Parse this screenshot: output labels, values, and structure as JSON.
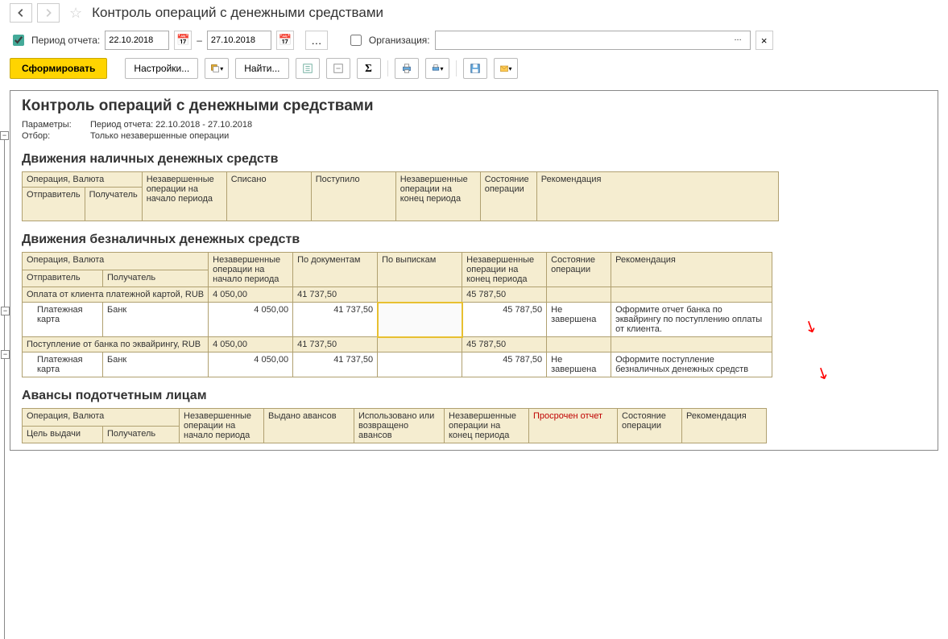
{
  "title": "Контроль операций с денежными средствами",
  "params": {
    "period_label": "Период отчета:",
    "from": "22.10.2018",
    "to": "27.10.2018",
    "dash": "–",
    "org_label": "Организация:",
    "org_ellipsis": "...",
    "clear": "×"
  },
  "toolbar": {
    "form": "Сформировать",
    "settings": "Настройки...",
    "find": "Найти..."
  },
  "report": {
    "title": "Контроль операций с денежными средствами",
    "meta": {
      "params_label": "Параметры:",
      "params_value": "Период отчета: 22.10.2018 - 27.10.2018",
      "filter_label": "Отбор:",
      "filter_value": "Только незавершенные операции"
    },
    "section1": {
      "title": "Движения наличных денежных средств",
      "headers": {
        "op": "Операция, Валюта",
        "unfinished_start": "Незавершенные операции на начало периода",
        "written_off": "Списано",
        "received": "Поступило",
        "unfinished_end": "Незавершенные операции на конец периода",
        "state": "Состояние операции",
        "rec": "Рекомендация",
        "sender": "Отправитель",
        "recipient": "Получатель"
      }
    },
    "section2": {
      "title": "Движения безналичных денежных средств",
      "headers": {
        "op": "Операция, Валюта",
        "unfinished_start": "Незавершенные операции на начало периода",
        "by_docs": "По документам",
        "by_statements": "По выпискам",
        "unfinished_end": "Незавершенные операции на конец периода",
        "state": "Состояние операции",
        "rec": "Рекомендация",
        "sender": "Отправитель",
        "recipient": "Получатель"
      },
      "rows": {
        "g1": "Оплата от клиента платежной картой, RUB",
        "g1_start": "4 050,00",
        "g1_docs": "41 737,50",
        "g1_stmts": "",
        "g1_end": "45 787,50",
        "d1_sender": "Платежная карта",
        "d1_recipient": "Банк",
        "d1_start": "4 050,00",
        "d1_docs": "41 737,50",
        "d1_end": "45 787,50",
        "d1_state": "Не завершена",
        "d1_rec": "Оформите отчет банка по эквайрингу по поступлению оплаты от клиента.",
        "g2": "Поступление от банка по эквайрингу, RUB",
        "g2_start": "4 050,00",
        "g2_docs": "41 737,50",
        "g2_end": "45 787,50",
        "d2_sender": "Платежная карта",
        "d2_recipient": "Банк",
        "d2_start": "4 050,00",
        "d2_docs": "41 737,50",
        "d2_end": "45 787,50",
        "d2_state": "Не завершена",
        "d2_rec": "Оформите поступление безналичных денежных средств"
      }
    },
    "section3": {
      "title": "Авансы подотчетным лицам",
      "headers": {
        "op": "Операция, Валюта",
        "unfinished_start": "Незавершенные операции на начало периода",
        "issued": "Выдано авансов",
        "used": "Использовано или возвращено авансов",
        "unfinished_end": "Незавершенные операции на конец периода",
        "overdue": "Просрочен отчет",
        "state": "Состояние операции",
        "rec": "Рекомендация",
        "purpose": "Цель выдачи",
        "recipient": "Получатель"
      }
    }
  }
}
